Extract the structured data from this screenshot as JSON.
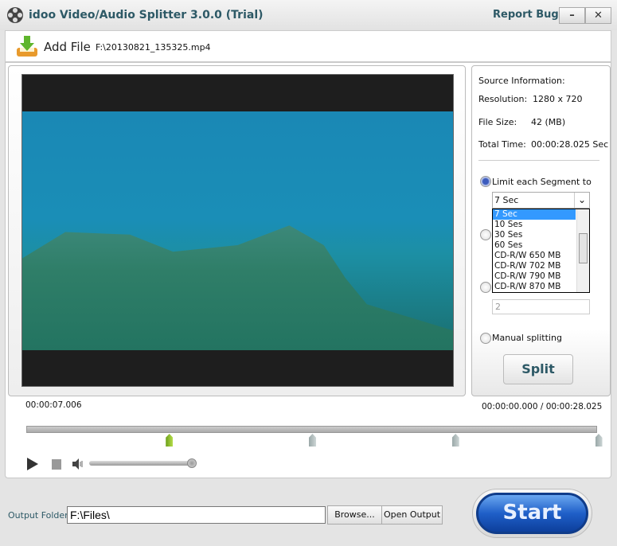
{
  "window": {
    "title": "idoo Video/Audio Splitter 3.0.0 (Trial)",
    "report_bugs": "Report Bugs",
    "minimize": "–",
    "close": "✕"
  },
  "toolbar": {
    "add_file": "Add File",
    "file_path": "F:\\20130821_135325.mp4"
  },
  "source_info": {
    "heading": "Source Information:",
    "resolution_label": "Resolution:",
    "resolution": "1280 x 720",
    "file_size_label": "File Size:",
    "file_size": "42 (MB)",
    "total_time_label": "Total Time:",
    "total_time": "00:00:28.025 Sec"
  },
  "split_options": {
    "limit_label": "Limit each Segment to",
    "limit_selected": true,
    "combo_value": "7 Sec",
    "options": [
      "7 Sec",
      "10 Ses",
      "30 Ses",
      "60 Ses",
      "CD-R/W 650 MB",
      "CD-R/W 702 MB",
      "CD-R/W 790 MB",
      "CD-R/W 870 MB"
    ],
    "spin_value": "2",
    "manual_label": "Manual splitting",
    "split_button": "Split"
  },
  "player": {
    "current_time": "00:00:07.006",
    "position": "00:00:00.000 / 00:00:28.025",
    "markers_seconds": [
      7.006,
      14.012,
      21.018,
      28.025
    ],
    "active_marker": 0,
    "volume_percent": 100
  },
  "output": {
    "label": "Output Folder:",
    "folder": "F:\\Files\\",
    "browse": "Browse...",
    "open_output": "Open Output",
    "start": "Start"
  },
  "colors": {
    "accent": "#2d5966",
    "start_button": "#1f5fc8",
    "selection": "#3399ff"
  }
}
